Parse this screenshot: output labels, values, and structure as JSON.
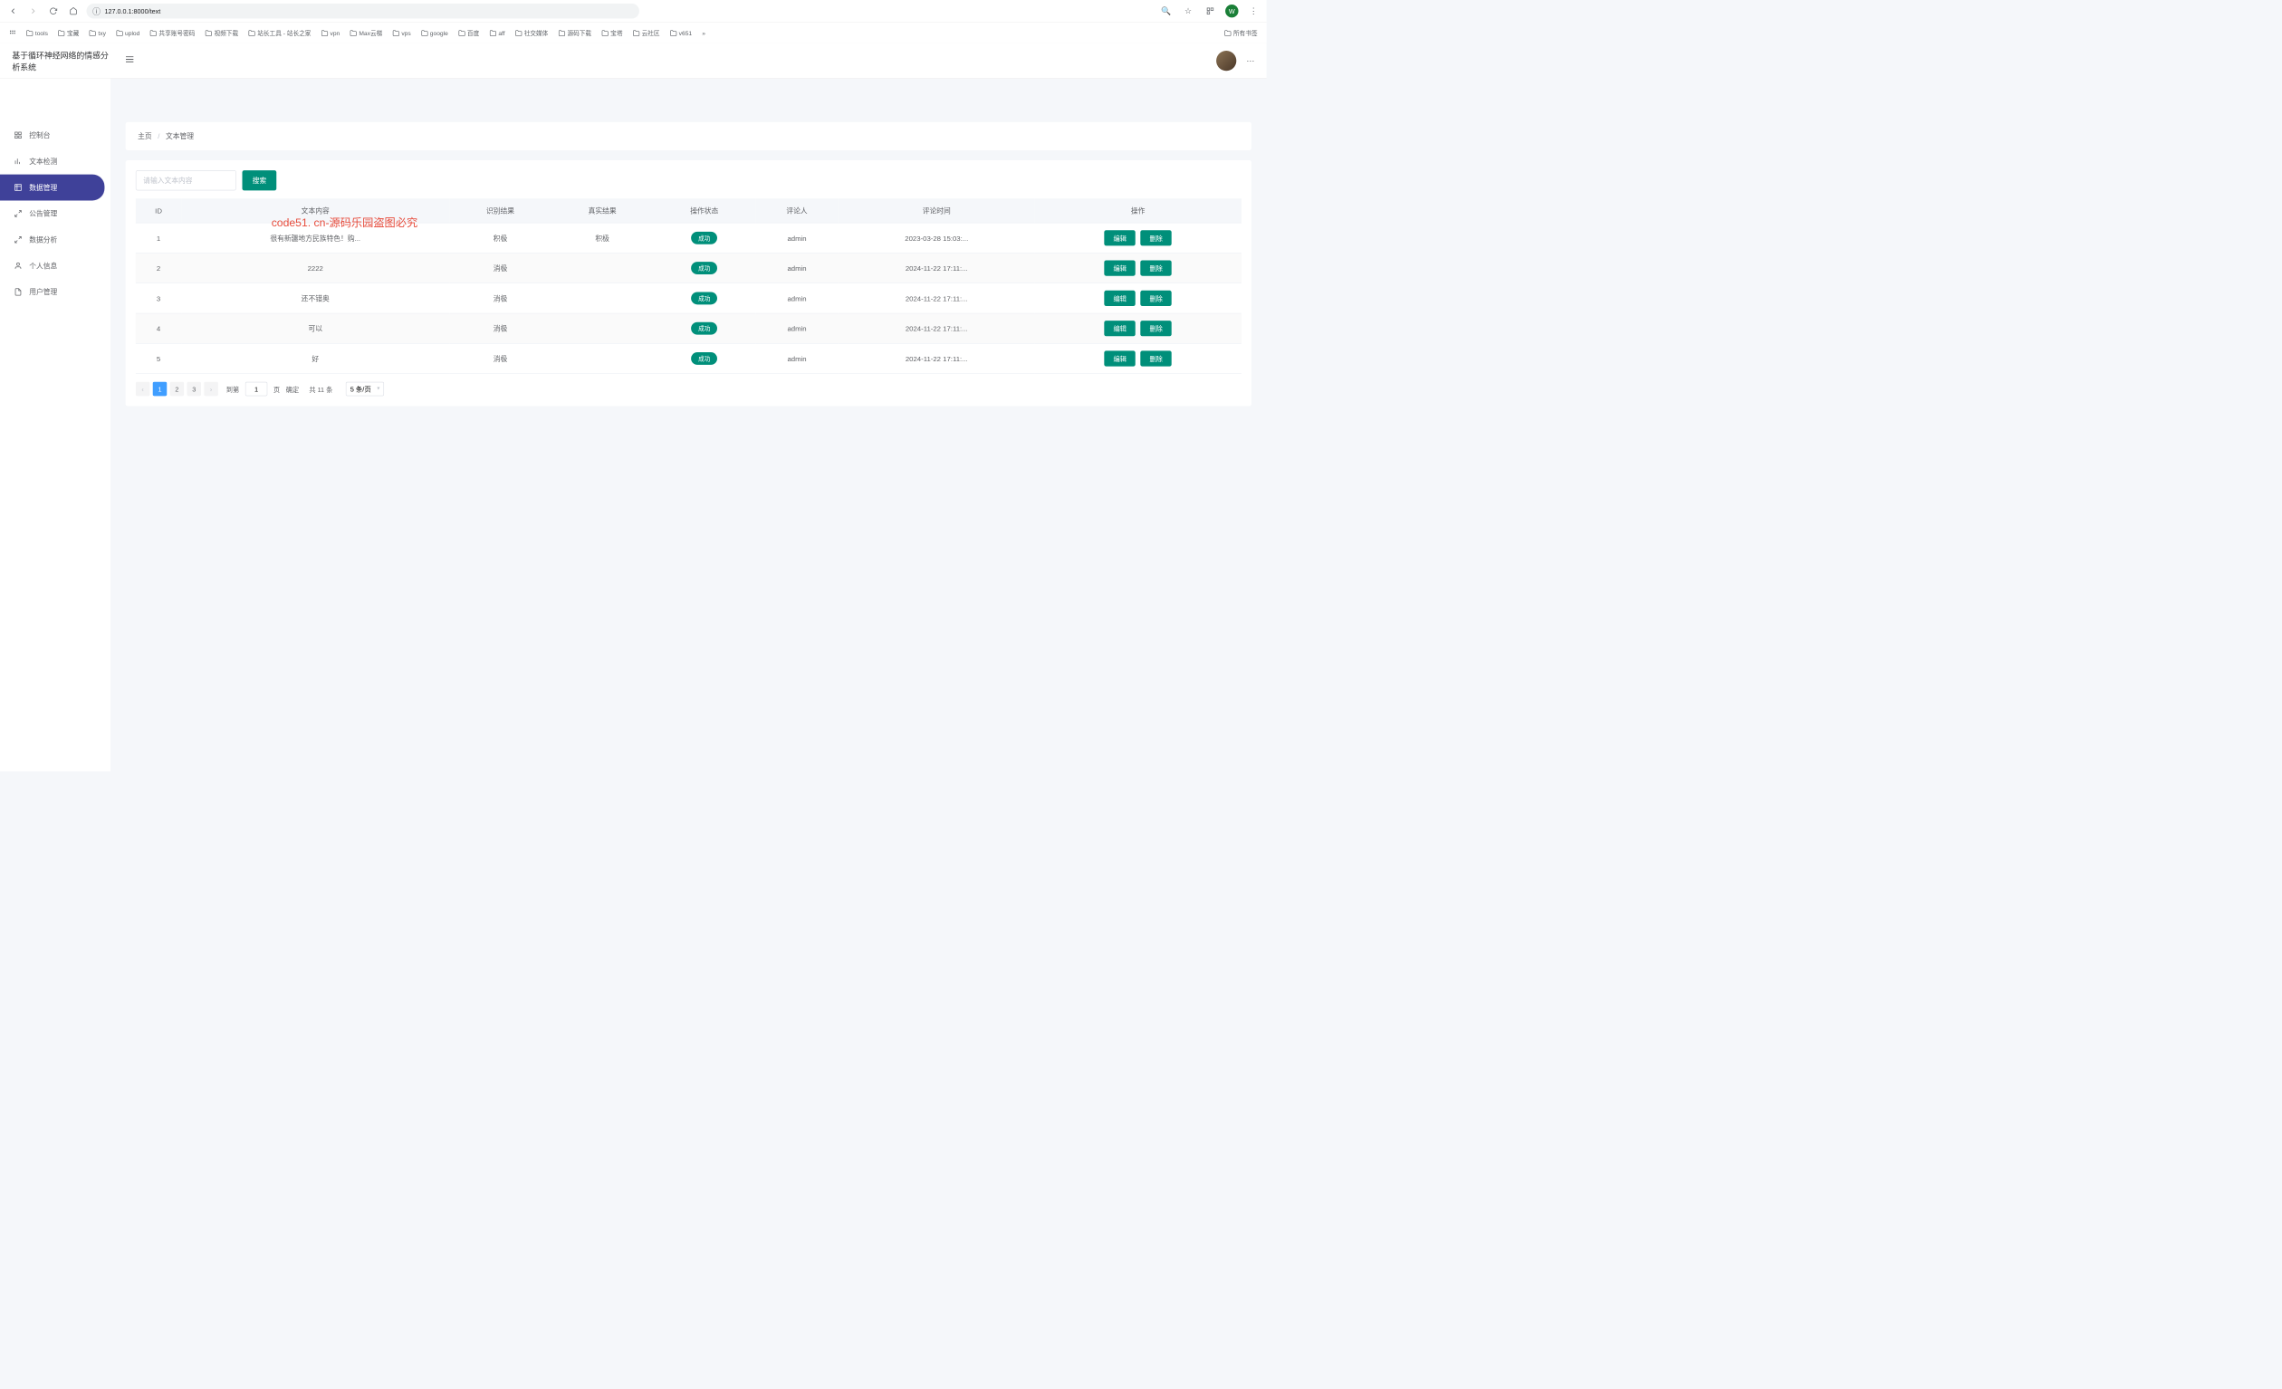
{
  "browser": {
    "url": "127.0.0.1:8000/text",
    "profile_letter": "W",
    "bookmarks": [
      "tools",
      "宝藏",
      "txy",
      "uplod",
      "共享账号密码",
      "视频下载",
      "站长工具 - 站长之家",
      "vpn",
      "Max云梯",
      "vps",
      "google",
      "百度",
      "aff",
      "社交媒体",
      "源码下载",
      "宝塔",
      "云社区",
      "v651"
    ],
    "all_bookmarks_label": "所有书签"
  },
  "app": {
    "title": "基于循环神经网络的情感分析系统",
    "menu": [
      {
        "label": "控制台",
        "icon": "grid"
      },
      {
        "label": "文本检测",
        "icon": "bars"
      },
      {
        "label": "数据管理",
        "icon": "table",
        "active": true
      },
      {
        "label": "公告管理",
        "icon": "expand"
      },
      {
        "label": "数据分析",
        "icon": "expand"
      },
      {
        "label": "个人信息",
        "icon": "user"
      },
      {
        "label": "用户管理",
        "icon": "doc"
      }
    ],
    "breadcrumb": {
      "home": "主页",
      "current": "文本管理"
    },
    "search": {
      "placeholder": "请输入文本内容",
      "button": "搜索"
    },
    "table": {
      "headers": [
        "ID",
        "文本内容",
        "识别结果",
        "真实结果",
        "操作状态",
        "评论人",
        "评论时间",
        "操作"
      ],
      "edit_label": "编辑",
      "delete_label": "删除",
      "status_success": "成功",
      "rows": [
        {
          "id": "1",
          "content": "很有新疆地方民族特色！购...",
          "detect": "积极",
          "real": "积极",
          "user": "admin",
          "time": "2023-03-28 15:03:..."
        },
        {
          "id": "2",
          "content": "2222",
          "detect": "消极",
          "real": "",
          "user": "admin",
          "time": "2024-11-22 17:11:..."
        },
        {
          "id": "3",
          "content": "还不错奥",
          "detect": "消极",
          "real": "",
          "user": "admin",
          "time": "2024-11-22 17:11:..."
        },
        {
          "id": "4",
          "content": "可以",
          "detect": "消极",
          "real": "",
          "user": "admin",
          "time": "2024-11-22 17:11:..."
        },
        {
          "id": "5",
          "content": "好",
          "detect": "消极",
          "real": "",
          "user": "admin",
          "time": "2024-11-22 17:11:..."
        }
      ]
    },
    "pagination": {
      "pages": [
        "1",
        "2",
        "3"
      ],
      "active": "1",
      "goto_label": "到第",
      "goto_value": "1",
      "page_label": "页",
      "confirm": "确定",
      "total": "共 11 条",
      "page_size": "5 条/页"
    }
  },
  "watermark_red": "code51. cn-源码乐园盗图必究"
}
